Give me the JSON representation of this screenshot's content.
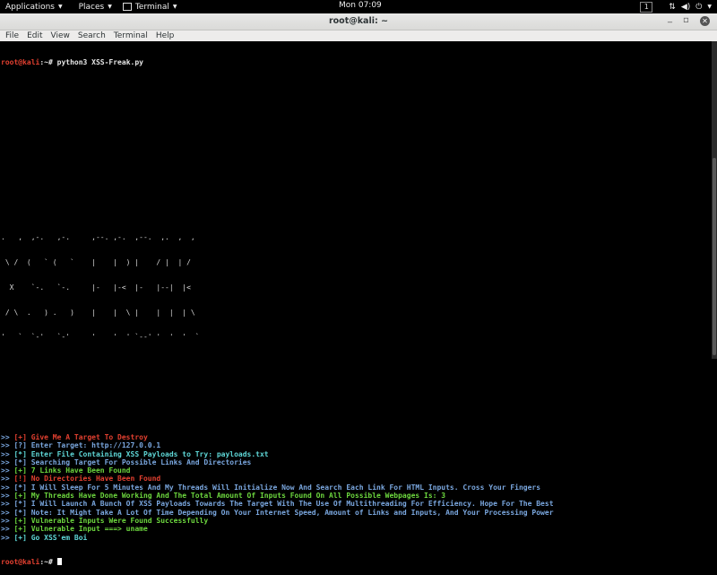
{
  "topbar": {
    "applications": "Applications",
    "places": "Places",
    "terminal": "Terminal",
    "clock": "Mon 07:09",
    "workspace": "1"
  },
  "window": {
    "title": "root@kali: ~"
  },
  "menubar": [
    "File",
    "Edit",
    "View",
    "Search",
    "Terminal",
    "Help"
  ],
  "terminal": {
    "prompt_user": "root@kali",
    "prompt_path": ":~# ",
    "command": "python3 XSS-Freak.py",
    "banner": [
      ".   ,  ,-.   ,-.     ,--. ,-.  ,--.  ,.  ,  ,",
      " \\ /  (   ` (   `    |    |  ) |    / |  | /",
      "  X    `-.   `-.     |-   |-<  |-   |--|  |<",
      " / \\  .   ) .   )    |    |  \\ |    |  |  | \\",
      "'   `  `-'   `-'     '    '  ' `--' '  '  '  `"
    ],
    "lines": [
      {
        "prefix": ">> ",
        "text": "[+] Give Me A Target To Destroy",
        "color": "#e34030"
      },
      {
        "prefix": ">> ",
        "text": "[?] Enter Target: http://127.0.0.1",
        "color": "#7aa7df"
      },
      {
        "prefix": ">> ",
        "text": "[*] Enter File Containing XSS Payloads to Try: payloads.txt",
        "color": "#5fd8d8"
      },
      {
        "prefix": ">> ",
        "text": "[*] Searching Target For Possible Links And Directories",
        "color": "#7aa7df"
      },
      {
        "prefix": ">> ",
        "text": "[+] 7 Links Have Been Found",
        "color": "#6cd63e"
      },
      {
        "prefix": ">> ",
        "text": "[!] No Directories Have Been Found",
        "color": "#e34030"
      },
      {
        "prefix": ">> ",
        "text": "[*] I Will Sleep For 5 Minutes And My Threads Will Initialize Now And Search Each Link For HTML Inputs. Cross Your Fingers",
        "color": "#7aa7df"
      },
      {
        "prefix": ">> ",
        "text": "[+] My Threads Have Done Working And The Total Amount Of Inputs Found On All Possible Webpages Is: 3",
        "color": "#6cd63e"
      },
      {
        "prefix": ">> ",
        "text": "[*] I Will Launch A Bunch Of XSS Payloads Towards The Target With The Use Of Multithreading For Efficiency. Hope For The Best",
        "color": "#7aa7df"
      },
      {
        "prefix": ">> ",
        "text": "[*] Note: It Might Take A Lot Of Time Depending On Your Internet Speed, Amount of Links and Inputs, And Your Processing Power",
        "color": "#7aa7df"
      },
      {
        "prefix": ">> ",
        "text": "[+] Vulnerable Inputs Were Found Successfully",
        "color": "#6cd63e"
      },
      {
        "prefix": ">> ",
        "text": "[+] Vulnerable Input ===> uname",
        "color": "#6cd63e"
      },
      {
        "prefix": ">> ",
        "text": "[+] Go XSS'em Boi",
        "color": "#5fd8d8"
      }
    ]
  },
  "colors": {
    "prompt": "#e34030",
    "background": "#000000",
    "titlebar": "#e8e8e7"
  }
}
